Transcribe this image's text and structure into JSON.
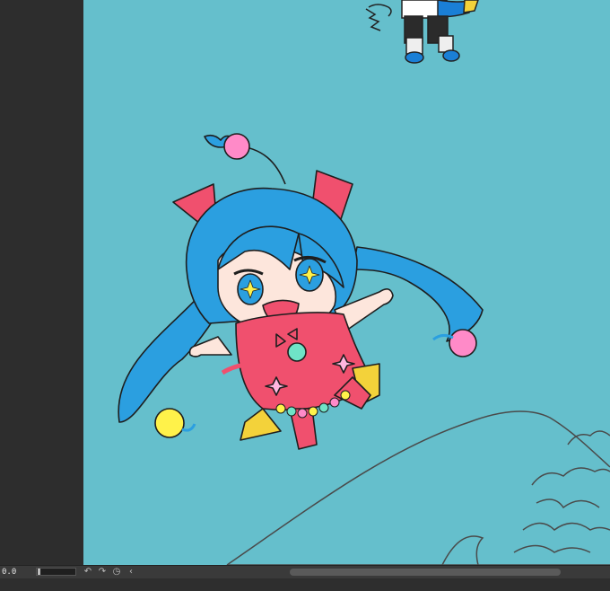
{
  "statusbar": {
    "zoom_value": "0.0",
    "icons": [
      "undo-icon",
      "redo-icon",
      "reset-rotation-icon",
      "collapse-icon"
    ]
  },
  "colors": {
    "canvas_bg": "#65bfcc",
    "panel_bg": "#2d2d2d",
    "hair": "#2b9fe0",
    "dress": "#f0506e",
    "pompom_pink": "#ff8ac8",
    "pompom_yellow": "#fff24a"
  }
}
